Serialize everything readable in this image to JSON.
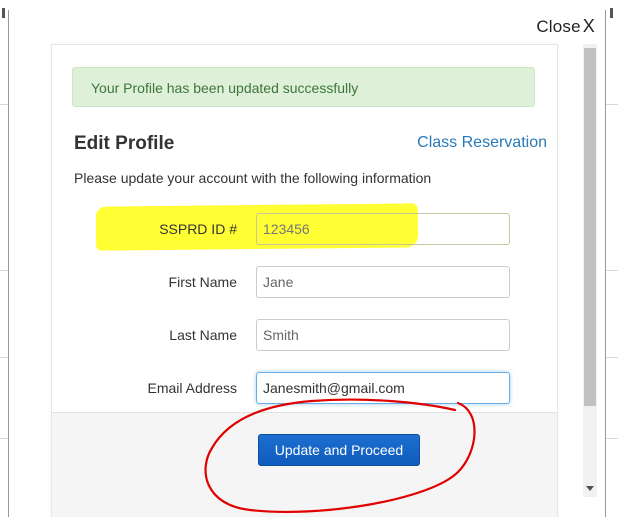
{
  "dialog": {
    "close_label": "Close",
    "close_glyph": "X"
  },
  "alert": {
    "message": "Your Profile has been updated successfully",
    "color": "#dff0d8"
  },
  "header": {
    "title": "Edit Profile",
    "link_label": "Class Reservation"
  },
  "instructions": "Please update your account with the following information",
  "form": {
    "fields": [
      {
        "label": "SSPRD ID #",
        "value": "123456"
      },
      {
        "label": "First Name",
        "value": "Jane"
      },
      {
        "label": "Last Name",
        "value": "Smith"
      },
      {
        "label": "Email Address",
        "value": "Janesmith@gmail.com"
      }
    ]
  },
  "footer": {
    "submit_label": "Update and Proceed",
    "button_color": "#1e6fd1"
  },
  "annotations": {
    "highlight_color": "#ffff33",
    "circle_color": "#e00000"
  }
}
